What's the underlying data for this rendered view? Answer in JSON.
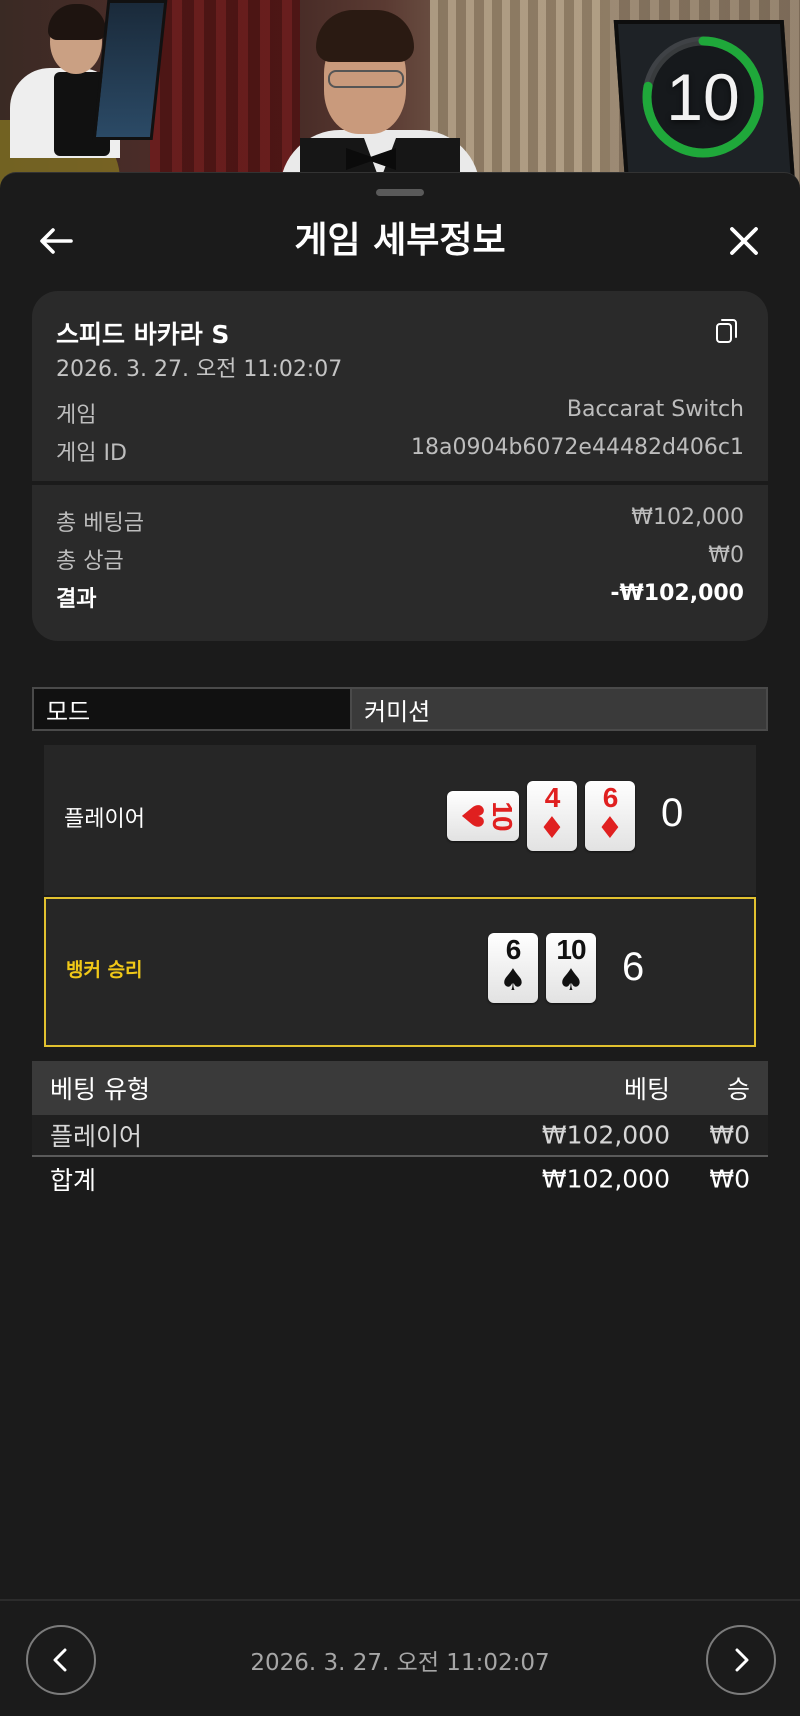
{
  "timer": {
    "value": "10",
    "progress": 0.78,
    "ring_color": "#1fa83a"
  },
  "header": {
    "title": "게임 세부정보"
  },
  "summary": {
    "game_name": "스피드 바카라 S",
    "datetime": "2026. 3. 27. 오전 11:02:07",
    "rows": [
      {
        "label": "게임",
        "value": "Baccarat Switch"
      },
      {
        "label": "게임 ID",
        "value": "18a0904b6072e44482d406c1"
      }
    ],
    "totals": [
      {
        "label": "총 베팅금",
        "value": "₩102,000"
      },
      {
        "label": "총 상금",
        "value": "₩0"
      },
      {
        "label": "결과",
        "value": "-₩102,000"
      }
    ]
  },
  "tabs": [
    {
      "label": "모드",
      "active": true
    },
    {
      "label": "커미션",
      "active": false
    }
  ],
  "player": {
    "label": "플레이어",
    "score": "0",
    "cards": [
      {
        "rank": "10",
        "suit": "♥",
        "color": "red",
        "rotated": true
      },
      {
        "rank": "4",
        "suit": "♦",
        "color": "red",
        "rotated": false
      },
      {
        "rank": "6",
        "suit": "♦",
        "color": "red",
        "rotated": false
      }
    ]
  },
  "banker": {
    "label": "뱅커 승리",
    "score": "6",
    "highlight_color": "#e1c12f",
    "cards": [
      {
        "rank": "6",
        "suit": "♠",
        "color": "black",
        "rotated": false
      },
      {
        "rank": "10",
        "suit": "♠",
        "color": "black",
        "rotated": false
      }
    ]
  },
  "bets": {
    "headers": {
      "type": "베팅 유형",
      "bet": "베팅",
      "win": "승"
    },
    "rows": [
      {
        "type": "플레이어",
        "bet": "₩102,000",
        "win": "₩0"
      }
    ],
    "total": {
      "type": "합계",
      "bet": "₩102,000",
      "win": "₩0"
    }
  },
  "footer": {
    "datetime": "2026. 3. 27. 오전 11:02:07"
  },
  "icons": {
    "back": "arrow-left-icon",
    "close": "close-icon",
    "copy": "copy-icon",
    "prev": "chevron-left-icon",
    "next": "chevron-right-icon"
  }
}
